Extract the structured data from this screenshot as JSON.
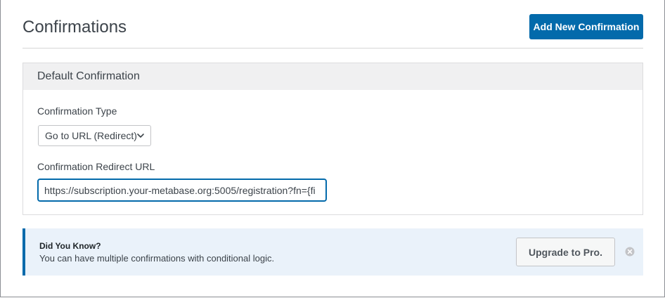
{
  "header": {
    "title": "Confirmations",
    "add_button_label": "Add New Confirmation"
  },
  "panel": {
    "title": "Default Confirmation",
    "type_label": "Confirmation Type",
    "type_value": "Go to URL (Redirect)",
    "url_label": "Confirmation Redirect URL",
    "url_value": "https://subscription.your-metabase.org:5005/registration?fn={fi"
  },
  "notice": {
    "title": "Did You Know?",
    "text": "You can have multiple confirmations with conditional logic.",
    "upgrade_label": "Upgrade to Pro.",
    "dismiss_icon": "close-circle-icon"
  },
  "colors": {
    "accent": "#036aab",
    "notice_bg": "#eaf2fa",
    "panel_header_bg": "#f0f0f1"
  }
}
